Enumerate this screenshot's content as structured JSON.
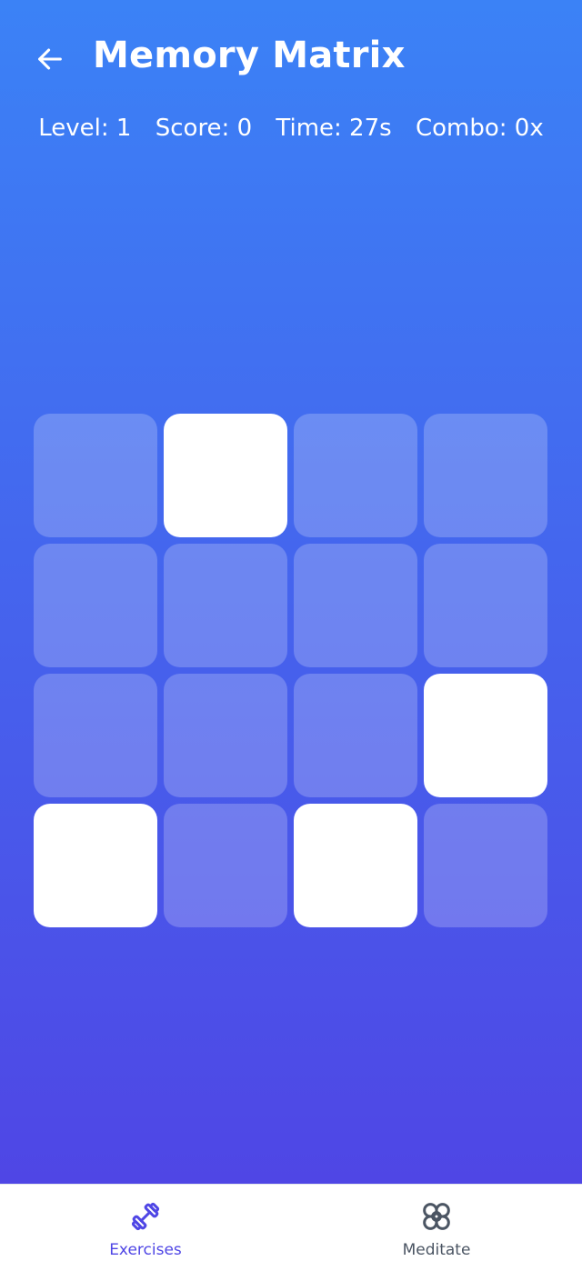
{
  "header": {
    "back_icon": "arrow-left-icon",
    "title": "Memory Matrix"
  },
  "stats": {
    "level": "Level: 1",
    "score": "Score: 0",
    "time": "Time: 27s",
    "combo": "Combo: 0x"
  },
  "grid": {
    "rows": 4,
    "cols": 4,
    "highlighted": [
      [
        false,
        true,
        false,
        false
      ],
      [
        false,
        false,
        false,
        false
      ],
      [
        false,
        false,
        false,
        true
      ],
      [
        true,
        false,
        true,
        false
      ]
    ]
  },
  "bottom_nav": {
    "items": [
      {
        "label": "Exercises",
        "icon": "dumbbell-icon",
        "active": true
      },
      {
        "label": "Meditate",
        "icon": "flower-icon",
        "active": false
      }
    ]
  },
  "colors": {
    "gradient_top": "#3b82f6",
    "gradient_bottom": "#4f46e5",
    "active_nav": "#4f46e5",
    "inactive_nav": "#4b5563"
  }
}
